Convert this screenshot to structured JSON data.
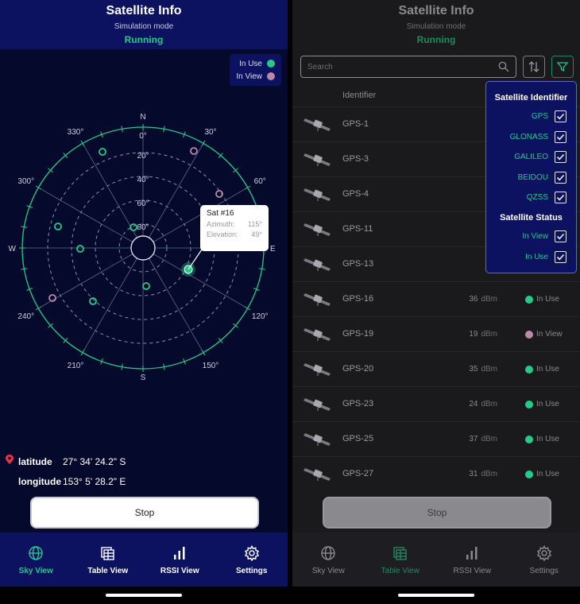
{
  "header": {
    "title": "Satellite Info",
    "subtitle": "Simulation mode",
    "status": "Running"
  },
  "legend": {
    "items": [
      {
        "label": "In Use",
        "color": "#27c98a"
      },
      {
        "label": "In View",
        "color": "#b98aa8"
      }
    ]
  },
  "sky": {
    "compass": {
      "n": "N",
      "s": "S",
      "e": "E",
      "w": "W"
    },
    "azimuth_labels": [
      "30°",
      "60°",
      "120°",
      "150°",
      "210°",
      "240°",
      "300°",
      "330°"
    ],
    "elevation_labels": [
      "0°",
      "20°",
      "40°",
      "60°",
      "80°"
    ],
    "tooltip": {
      "title": "Sat #16",
      "azimuth_label": "Azimuth:",
      "azimuth_value": "115°",
      "elevation_label": "Elevation:",
      "elevation_value": "49°"
    }
  },
  "location": {
    "latitude_label": "latitude",
    "latitude_value": "27° 34' 24.2\" S",
    "longitude_label": "longitude",
    "longitude_value": "153° 5' 28.2\" E"
  },
  "stop_label": "Stop",
  "nav": {
    "items": [
      {
        "label": "Sky View",
        "icon": "globe-icon"
      },
      {
        "label": "Table View",
        "icon": "table-icon"
      },
      {
        "label": "RSSI View",
        "icon": "bar-chart-icon"
      },
      {
        "label": "Settings",
        "icon": "gear-icon"
      }
    ]
  },
  "table": {
    "search_placeholder": "Search",
    "column_identifier": "Identifier",
    "rows": [
      {
        "id": "GPS-1",
        "signal": "",
        "unit": "",
        "status": ""
      },
      {
        "id": "GPS-3",
        "signal": "",
        "unit": "",
        "status": ""
      },
      {
        "id": "GPS-4",
        "signal": "",
        "unit": "",
        "status": ""
      },
      {
        "id": "GPS-11",
        "signal": "",
        "unit": "",
        "status": ""
      },
      {
        "id": "GPS-13",
        "signal": "",
        "unit": "",
        "status": ""
      },
      {
        "id": "GPS-16",
        "signal": "36",
        "unit": "dBm",
        "status": "In Use"
      },
      {
        "id": "GPS-19",
        "signal": "19",
        "unit": "dBm",
        "status": "In View"
      },
      {
        "id": "GPS-20",
        "signal": "35",
        "unit": "dBm",
        "status": "In Use"
      },
      {
        "id": "GPS-23",
        "signal": "24",
        "unit": "dBm",
        "status": "In Use"
      },
      {
        "id": "GPS-25",
        "signal": "37",
        "unit": "dBm",
        "status": "In Use"
      },
      {
        "id": "GPS-27",
        "signal": "31",
        "unit": "dBm",
        "status": "In Use"
      }
    ]
  },
  "filter": {
    "identifier_heading": "Satellite Identifier",
    "identifiers": [
      "GPS",
      "GLONASS",
      "GALILEO",
      "BEIDOU",
      "QZSS"
    ],
    "status_heading": "Satellite Status",
    "statuses": [
      "In View",
      "In Use"
    ]
  },
  "colors": {
    "accent_green": "#27c98a",
    "in_view": "#b98aa8",
    "header_navy": "#0c1260",
    "background_navy": "#050a2c"
  }
}
